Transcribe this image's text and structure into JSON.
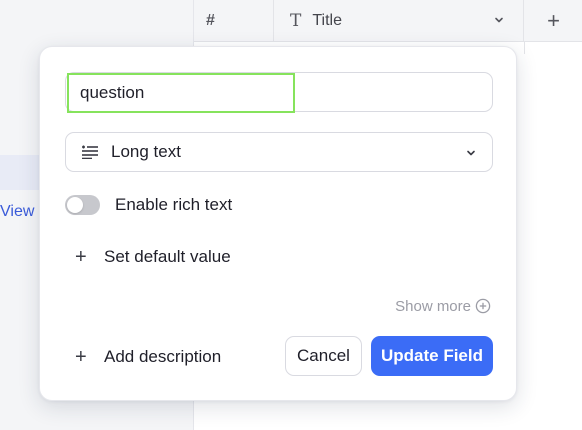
{
  "background": {
    "sidebar_link": "View",
    "grid_header": {
      "hash_label": "#",
      "title_icon": "text-type-icon",
      "title_label": "Title",
      "add_column_icon": "+"
    }
  },
  "field_editor": {
    "name_value": "question",
    "name_placeholder": "",
    "type_icon": "long-text-icon",
    "type_label": "Long text",
    "rich_text_label": "Enable rich text",
    "rich_text_enabled": false,
    "default_value_label": "Set default value",
    "show_more_label": "Show more",
    "add_description_label": "Add description",
    "cancel_label": "Cancel",
    "update_label": "Update Field"
  },
  "colors": {
    "accent": "#3b6cf6",
    "focus_outline": "#86e35c",
    "toggle_off": "#c7c8cd",
    "link": "#3a5bd9"
  }
}
